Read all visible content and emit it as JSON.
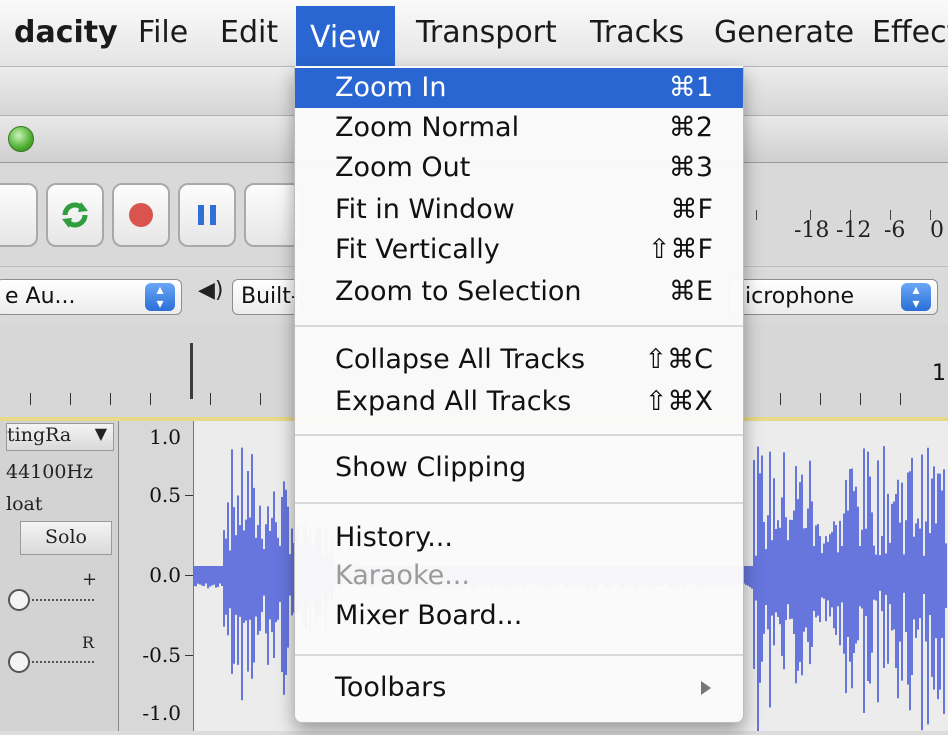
{
  "menubar": {
    "app": "dacity",
    "items": [
      "File",
      "Edit",
      "View",
      "Transport",
      "Tracks",
      "Generate",
      "Effect"
    ]
  },
  "device_bar": {
    "host": "e Au...",
    "output": "Built-",
    "input": "icrophone"
  },
  "meter_scale": [
    "-18",
    "-12",
    "-6",
    "0"
  ],
  "ruler": {
    "label": "1"
  },
  "track": {
    "name": "tingRa",
    "rate": "44100Hz",
    "format": "loat",
    "solo_label": "Solo",
    "gain_mark": "+",
    "pan_mark": "R"
  },
  "y_axis": [
    "1.0",
    "0.5",
    "0.0",
    "-0.5",
    "-1.0"
  ],
  "view_menu": {
    "items": [
      {
        "label": "Zoom In",
        "shortcut": "⌘1",
        "selected": true
      },
      {
        "label": "Zoom Normal",
        "shortcut": "⌘2"
      },
      {
        "label": "Zoom Out",
        "shortcut": "⌘3"
      },
      {
        "label": "Fit in Window",
        "shortcut": "⌘F"
      },
      {
        "label": "Fit Vertically",
        "shortcut": "⇧⌘F"
      },
      {
        "label": "Zoom to Selection",
        "shortcut": "⌘E"
      },
      {
        "label": "Collapse All Tracks",
        "shortcut": "⇧⌘C"
      },
      {
        "label": "Expand All Tracks",
        "shortcut": "⇧⌘X"
      },
      {
        "label": "Show Clipping",
        "shortcut": ""
      },
      {
        "label": "History...",
        "shortcut": ""
      },
      {
        "label": "Karaoke...",
        "shortcut": "",
        "disabled": true
      },
      {
        "label": "Mixer Board...",
        "shortcut": ""
      },
      {
        "label": "Toolbars",
        "shortcut": "",
        "submenu": true
      }
    ]
  },
  "colors": {
    "menu_highlight": "#2a66d1",
    "waveform": "#3a4fd8",
    "record_red": "#d9534f",
    "pause_blue": "#2f6fd6",
    "loop_green": "#2f9e3e"
  },
  "icons": [
    "loop-icon",
    "record-icon",
    "pause-icon",
    "speaker-icon",
    "stepper-icon",
    "submenu-arrow-icon",
    "track-menu-arrow-icon"
  ]
}
